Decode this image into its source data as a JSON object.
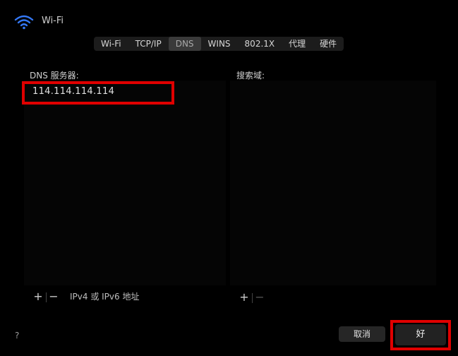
{
  "window": {
    "title": "Wi-Fi"
  },
  "tabs": [
    {
      "label": "Wi-Fi"
    },
    {
      "label": "TCP/IP"
    },
    {
      "label": "DNS"
    },
    {
      "label": "WINS"
    },
    {
      "label": "802.1X"
    },
    {
      "label": "代理"
    },
    {
      "label": "硬件"
    }
  ],
  "active_tab": "DNS",
  "dns": {
    "label": "DNS 服务器:",
    "servers": [
      "114.114.114.114"
    ],
    "add": "+",
    "remove": "−",
    "hint": "IPv4 或 IPv6 地址"
  },
  "search": {
    "label": "搜索域:",
    "add": "+",
    "remove": "−"
  },
  "footer": {
    "help": "?",
    "cancel": "取消",
    "ok": "好"
  },
  "colors": {
    "highlight": "#e00000",
    "wifi_icon": "#3478f6"
  }
}
